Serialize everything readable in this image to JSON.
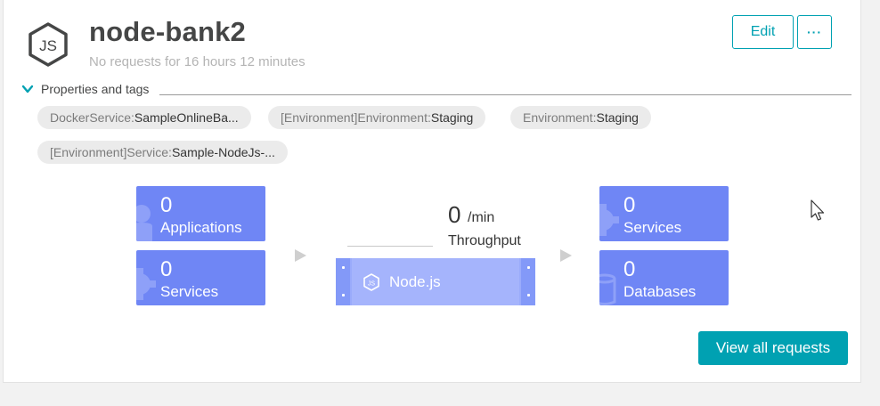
{
  "header": {
    "title": "node-bank2",
    "subtitle": "No requests for 16 hours 12 minutes",
    "edit_label": "Edit",
    "more_label": "···",
    "logo_icon": "nodejs-hexagon-icon"
  },
  "properties": {
    "toggle_label": "Properties and tags",
    "tags": [
      {
        "key": "DockerService: ",
        "value": "SampleOnlineBa..."
      },
      {
        "key": "[Environment]Environment: ",
        "value": "Staging"
      },
      {
        "key": "Environment: ",
        "value": "Staging"
      },
      {
        "key": "[Environment]Service: ",
        "value": "Sample-NodeJs-..."
      }
    ]
  },
  "flow": {
    "callers": [
      {
        "count": "0",
        "label": "Applications",
        "icon": "user-icon"
      },
      {
        "count": "0",
        "label": "Services",
        "icon": "gear-icon"
      }
    ],
    "throughput": {
      "value": "0",
      "unit": "/min",
      "label": "Throughput"
    },
    "process": {
      "name": "Node.js",
      "icon": "nodejs-icon"
    },
    "callees": [
      {
        "count": "0",
        "label": "Services",
        "icon": "gear-icon"
      },
      {
        "count": "0",
        "label": "Databases",
        "icon": "database-icon"
      }
    ]
  },
  "actions": {
    "view_all_label": "View all requests"
  },
  "colors": {
    "accent": "#00a1b2",
    "tile": "#6f86f5",
    "process": "#a5b4fc",
    "tag_bg": "#ebebeb"
  }
}
